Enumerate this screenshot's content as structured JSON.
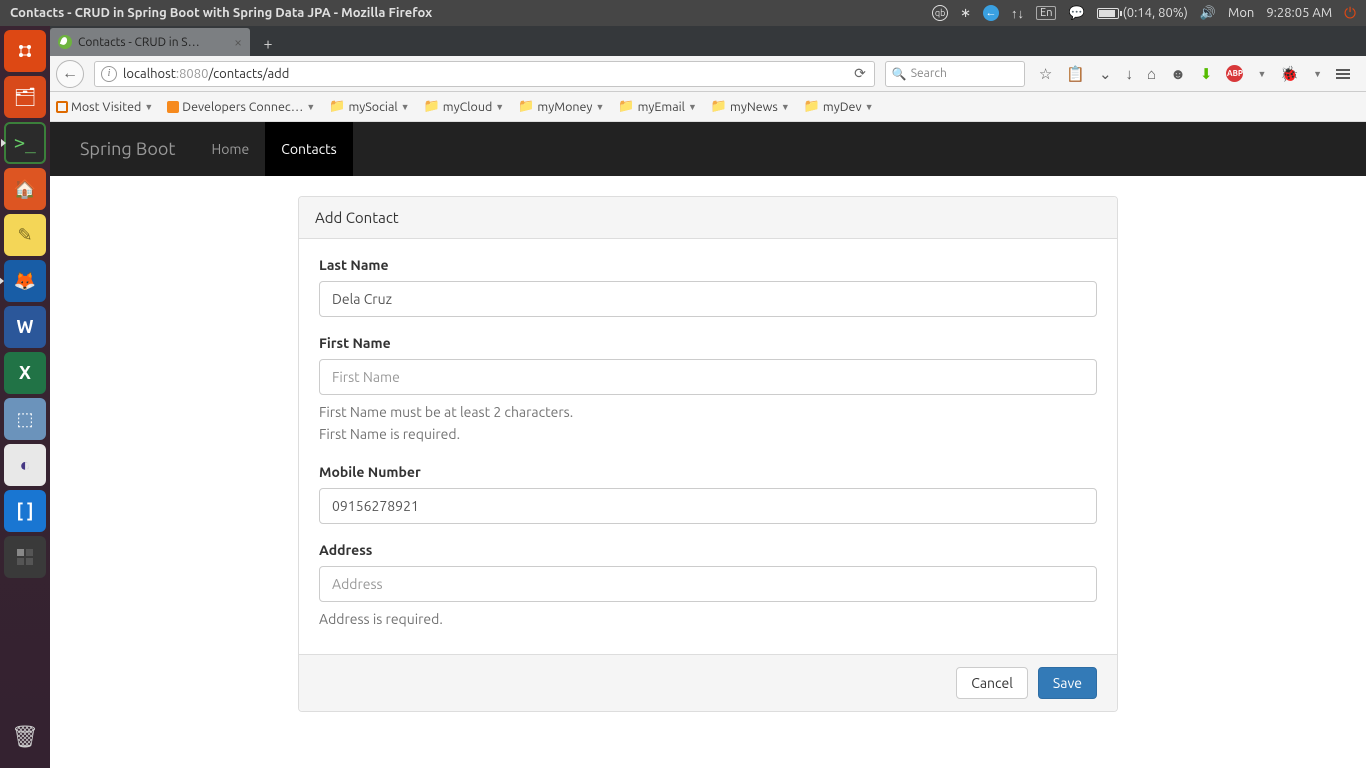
{
  "system": {
    "window_title": "Contacts - CRUD in Spring Boot with Spring Data JPA - Mozilla Firefox",
    "battery": "(0:14, 80%)",
    "day": "Mon",
    "time": "9:28:05 AM",
    "lang": "En"
  },
  "browser": {
    "tab_title": "Contacts - CRUD in S…",
    "url_host": "localhost",
    "url_port": ":8080",
    "url_path": "/contacts/add",
    "search_placeholder": "Search"
  },
  "bookmarks": [
    {
      "label": "Most Visited"
    },
    {
      "label": "Developers Connec…"
    },
    {
      "label": "mySocial"
    },
    {
      "label": "myCloud"
    },
    {
      "label": "myMoney"
    },
    {
      "label": "myEmail"
    },
    {
      "label": "myNews"
    },
    {
      "label": "myDev"
    }
  ],
  "navbar": {
    "brand": "Spring Boot",
    "links": [
      {
        "label": "Home",
        "active": false
      },
      {
        "label": "Contacts",
        "active": true
      }
    ]
  },
  "form": {
    "panel_title": "Add Contact",
    "last_name": {
      "label": "Last Name",
      "value": "Dela Cruz"
    },
    "first_name": {
      "label": "First Name",
      "placeholder": "First Name",
      "error1": "First Name must be at least 2 characters.",
      "error2": "First Name is required."
    },
    "mobile": {
      "label": "Mobile Number",
      "value": "09156278921"
    },
    "address": {
      "label": "Address",
      "placeholder": "Address",
      "error": "Address is required."
    },
    "cancel_label": "Cancel",
    "save_label": "Save"
  }
}
